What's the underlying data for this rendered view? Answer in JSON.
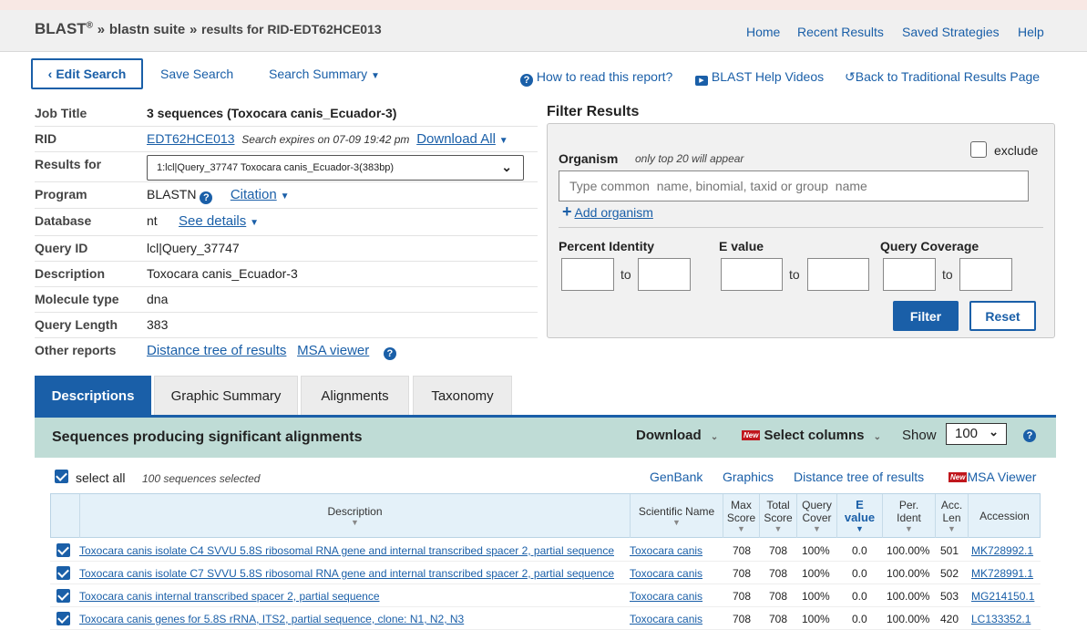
{
  "header": {
    "brand": "BLAST",
    "registered": "®",
    "crumb_sep": "»",
    "suite": "blastn suite",
    "results_for": "results for RID-EDT62HCE013",
    "nav": [
      "Home",
      "Recent Results",
      "Saved Strategies",
      "Help"
    ]
  },
  "toolbar": {
    "edit_search": "Edit Search",
    "save_search": "Save Search",
    "search_summary": "Search Summary",
    "how_to_read": "How to read this report?",
    "help_videos": "BLAST Help Videos",
    "back_traditional": "Back to Traditional Results Page"
  },
  "job": {
    "labels": {
      "title": "Job Title",
      "rid": "RID",
      "results_for": "Results for",
      "program": "Program",
      "database": "Database",
      "query_id": "Query ID",
      "description": "Description",
      "molecule_type": "Molecule type",
      "query_length": "Query Length",
      "other_reports": "Other reports"
    },
    "title": "3 sequences (Toxocara canis_Ecuador-3)",
    "rid": "EDT62HCE013",
    "expires": "Search expires on 07-09 19:42 pm",
    "download_all": "Download All",
    "results_for_selected": "1:lcl|Query_37747 Toxocara canis_Ecuador-3(383bp)",
    "program": "BLASTN",
    "citation": "Citation",
    "database": "nt",
    "see_details": "See details",
    "query_id": "lcl|Query_37747",
    "description": "Toxocara canis_Ecuador-3",
    "molecule_type": "dna",
    "query_length": "383",
    "distance_tree": "Distance tree of results",
    "msa_viewer": "MSA viewer"
  },
  "filter": {
    "title": "Filter Results",
    "organism_label": "Organism",
    "organism_hint": "only top 20 will appear",
    "exclude": "exclude",
    "organism_placeholder": "Type common  name, binomial, taxid or group  name",
    "add_organism": "Add organism",
    "percent_identity": "Percent Identity",
    "e_value": "E value",
    "query_coverage": "Query Coverage",
    "to": "to",
    "filter_btn": "Filter",
    "reset_btn": "Reset"
  },
  "tabs": [
    "Descriptions",
    "Graphic Summary",
    "Alignments",
    "Taxonomy"
  ],
  "results": {
    "heading": "Sequences producing significant alignments",
    "download": "Download",
    "new_badge": "New",
    "select_columns": "Select columns",
    "show": "Show",
    "show_value": "100",
    "select_all": "select all",
    "selected_count": "100 sequences selected",
    "links": [
      "GenBank",
      "Graphics",
      "Distance tree of results",
      "MSA Viewer"
    ],
    "columns": {
      "description": "Description",
      "scientific_name": "Scientific Name",
      "max_score_1": "Max",
      "max_score_2": "Score",
      "total_score_1": "Total",
      "total_score_2": "Score",
      "query_cover_1": "Query",
      "query_cover_2": "Cover",
      "e_value_1": "E",
      "e_value_2": "value",
      "per_ident_1": "Per.",
      "per_ident_2": "Ident",
      "acc_len_1": "Acc.",
      "acc_len_2": "Len",
      "accession": "Accession"
    },
    "rows": [
      {
        "description": "Toxocara canis isolate C4 SVVU 5.8S ribosomal RNA gene and internal transcribed spacer 2, partial sequence",
        "scientific_name": "Toxocara canis",
        "max_score": "708",
        "total_score": "708",
        "query_cover": "100%",
        "e_value": "0.0",
        "per_ident": "100.00%",
        "acc_len": "501",
        "accession": "MK728992.1"
      },
      {
        "description": "Toxocara canis isolate C7 SVVU 5.8S ribosomal RNA gene and internal transcribed spacer 2, partial sequence",
        "scientific_name": "Toxocara canis",
        "max_score": "708",
        "total_score": "708",
        "query_cover": "100%",
        "e_value": "0.0",
        "per_ident": "100.00%",
        "acc_len": "502",
        "accession": "MK728991.1"
      },
      {
        "description": "Toxocara canis internal transcribed spacer 2, partial sequence",
        "scientific_name": "Toxocara canis",
        "max_score": "708",
        "total_score": "708",
        "query_cover": "100%",
        "e_value": "0.0",
        "per_ident": "100.00%",
        "acc_len": "503",
        "accession": "MG214150.1"
      },
      {
        "description": "Toxocara canis genes for 5.8S rRNA, ITS2, partial sequence, clone: N1, N2, N3",
        "scientific_name": "Toxocara canis",
        "max_score": "708",
        "total_score": "708",
        "query_cover": "100%",
        "e_value": "0.0",
        "per_ident": "100.00%",
        "acc_len": "420",
        "accession": "LC133352.1"
      }
    ]
  }
}
